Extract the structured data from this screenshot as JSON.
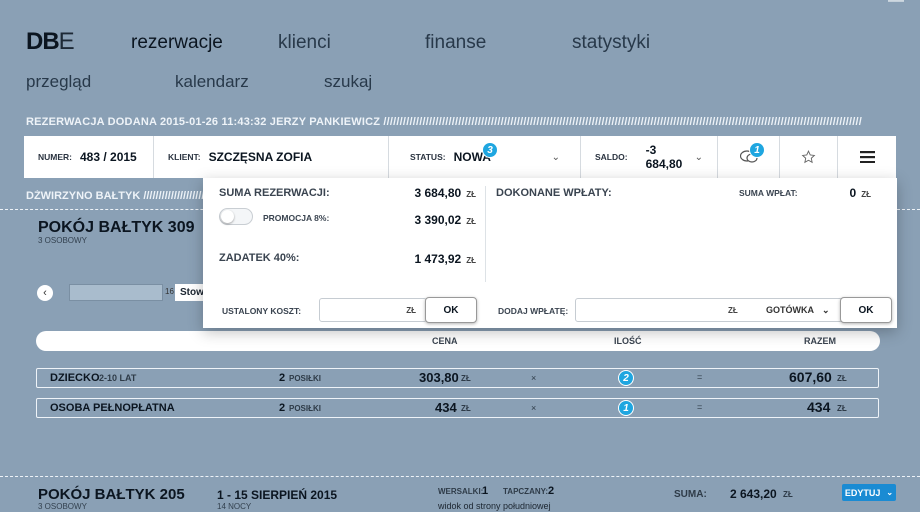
{
  "app": {
    "logo_bold": "DB",
    "logo_light": "E",
    "close_label": "—"
  },
  "nav": {
    "main": [
      "rezerwacje",
      "klienci",
      "finanse",
      "statystyki"
    ],
    "sub": [
      "przegląd",
      "kalendarz",
      "szukaj"
    ]
  },
  "header": {
    "added": "REZERWACJA DODANA 2015-01-26 11:43:32 JERZY PANKIEWICZ ///////////////////////////////////////////////////////////////////////////////////////////////////////////////////////////////////////////////////"
  },
  "topbar": {
    "numer_label": "NUMER:",
    "numer_value": "483 / 2015",
    "klient_label": "KLIENT:",
    "klient_value": "SZCZĘSNA ZOFIA",
    "status_label": "STATUS:",
    "status_value": "NOWA",
    "status_badge": "3",
    "saldo_label": "SALDO:",
    "saldo_value": "-3 684,80",
    "messages_badge": "1"
  },
  "panel": {
    "suma_label": "SUMA REZERWACJI:",
    "suma_value": "3 684,80",
    "promo_label": "PROMOCJA 8%:",
    "promo_value": "3 390,02",
    "zadatek_label": "ZADATEK 40%:",
    "zadatek_value": "1 473,92",
    "wplaty_label": "DOKONANE WPŁATY:",
    "suma_wplat_label": "SUMA WPŁAT:",
    "suma_wplat_value": "0",
    "currency": "ZŁ",
    "ustalony_label": "USTALONY KOSZT:",
    "dodaj_label": "DODAJ WPŁATĘ:",
    "payment_method": "GOTÓWKA",
    "ok": "OK"
  },
  "section": {
    "building": "DŹWIRZYNO BAŁTYK ///////////////////////////////////////////////////////////////////////////////////////////////",
    "room_title": "POKÓJ BAŁTYK 309",
    "room_sub": "3 OSOBOWY",
    "small_num": "16",
    "small_sel": "Stowa"
  },
  "columns": {
    "cena": "CENA",
    "ilosc": "ILOŚĆ",
    "razem": "RAZEM"
  },
  "rows": [
    {
      "name": "DZIECKO",
      "age": "2-10 LAT",
      "qty": "2",
      "unit": "POSIŁKI",
      "price": "303,80",
      "currency": "ZŁ",
      "times": "×",
      "count": "2",
      "eq": "=",
      "total": "607,60"
    },
    {
      "name": "OSOBA PEŁNOPŁATNA",
      "age": "",
      "qty": "2",
      "unit": "POSIŁKI",
      "price": "434",
      "currency": "ZŁ",
      "times": "×",
      "count": "1",
      "eq": "=",
      "total": "434"
    }
  ],
  "bottom": {
    "room_title": "POKÓJ BAŁTYK 205",
    "room_sub": "3 OSOBOWY",
    "dates": "1 - 15 SIERPIEŃ 2015",
    "nights": "14 NOCY",
    "wersalki_label": "WERSALKI:",
    "wersalki_value": "1",
    "tapczany_label": "TAPCZANY:",
    "tapczany_value": "2",
    "note": "widok od strony południowej",
    "suma_label": "SUMA:",
    "suma_value": "2 643,20",
    "currency": "ZŁ",
    "edit": "EDYTUJ"
  },
  "colors": {
    "background": "#8aa0b5",
    "accent": "#1fa6e0",
    "edit_button": "#1a8bd3"
  }
}
